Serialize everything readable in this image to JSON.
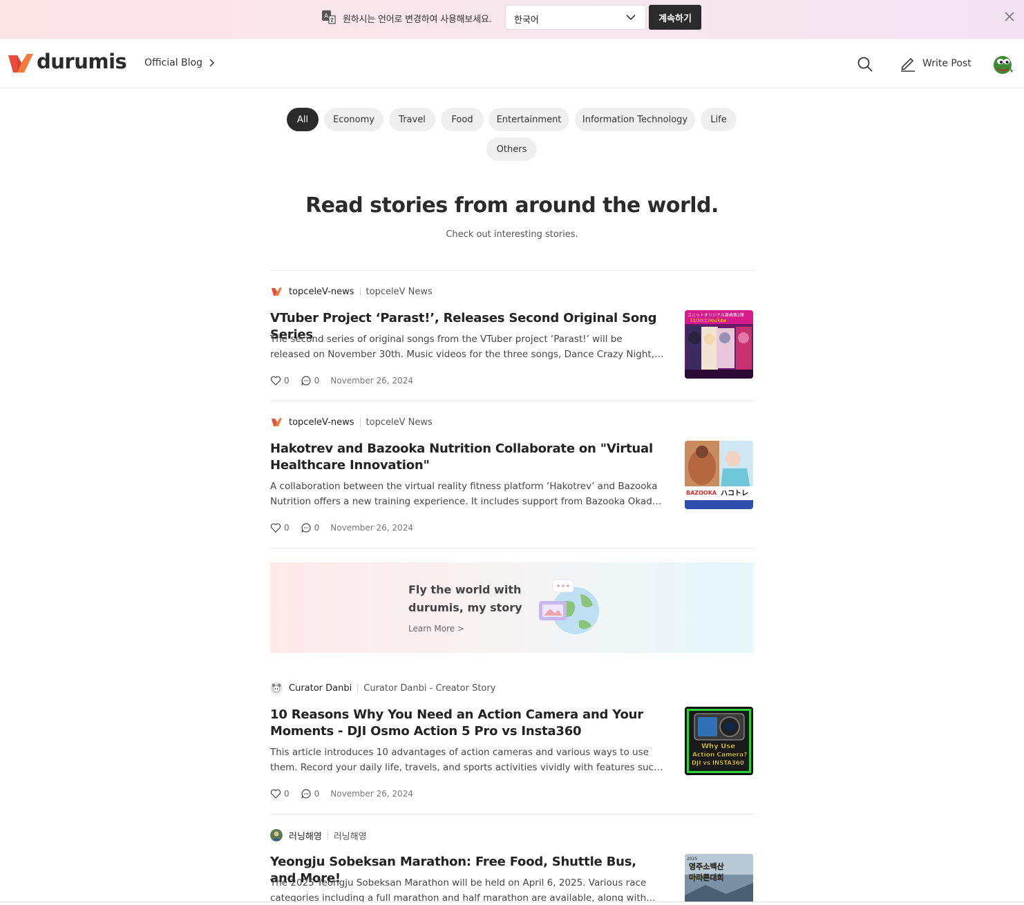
{
  "banner": {
    "message": "원하시는 언어로 변경하여 사용해보세요.",
    "language_value": "한국어",
    "continue_label": "계속하기"
  },
  "header": {
    "logo_text": "durumis",
    "blog_link": "Official Blog",
    "write_label": "Write Post"
  },
  "categories": [
    "All",
    "Economy",
    "Travel",
    "Food",
    "Entertainment",
    "Information Technology",
    "Life",
    "Others"
  ],
  "hero": {
    "title": "Read stories from around the world.",
    "subtitle": "Check out interesting stories."
  },
  "posts": [
    {
      "author": "topceleV-news",
      "blog": "topceleV News",
      "title": "VTuber Project ‘Parast!’, Releases Second Original Song Series",
      "excerpt": "The second series of original songs from the VTuber project ‘Parast!’ will be released on November 30th. Music videos for the three songs, Dance Crazy Night, Incompletion, and more will be released.",
      "likes": "0",
      "comments": "0",
      "date": "November 26, 2024",
      "thumb_text": "ユニットオリジナル楽曲第2弾 11/30(土)YouTube"
    },
    {
      "author": "topceleV-news",
      "blog": "topceleV News",
      "title": "Hakotrev and Bazooka Nutrition Collaborate on \"Virtual Healthcare Innovation\"",
      "excerpt": "A collaboration between the virtual reality fitness platform ‘Hakotrev’ and Bazooka Nutrition offers a new training experience. It includes support from Bazooka Okada, a professional.",
      "likes": "0",
      "comments": "0",
      "date": "November 26, 2024",
      "thumb_text": "BAZOOKA × ハコトレ"
    },
    {
      "author": "Curator Danbi",
      "blog": "Curator Danbi - Creator Story",
      "title": "10 Reasons Why You Need an Action Camera and Your Moments - DJI Osmo Action 5 Pro vs Insta360",
      "excerpt": "This article introduces 10 advantages of action cameras and various ways to use them. Record your daily life, travels, and sports activities vividly with features such as image stabilization.",
      "likes": "0",
      "comments": "0",
      "date": "November 26, 2024",
      "thumb_text": "Why Use Action Camera? DJI vs INSTA360"
    },
    {
      "author": "러닝해영",
      "blog": "러닝해영",
      "title": "Yeongju Sobeksan Marathon: Free Food, Shuttle Bus, and More!",
      "excerpt": "The 2025 Yeongju Sobeksan Marathon will be held on April 6, 2025. Various race categories including a full marathon and half marathon are available, along with free food.",
      "thumb_text": "2025 영주소백산 마라톤대회"
    }
  ],
  "promo": {
    "line1": "Fly the world with",
    "line2": "durumis, my story",
    "more": "Learn More >"
  },
  "colors": {
    "brand_red": "#e94b3c",
    "brand_orange": "#f27b3a",
    "chip_active": "#2b2b2b",
    "chip_bg": "#efefef"
  }
}
